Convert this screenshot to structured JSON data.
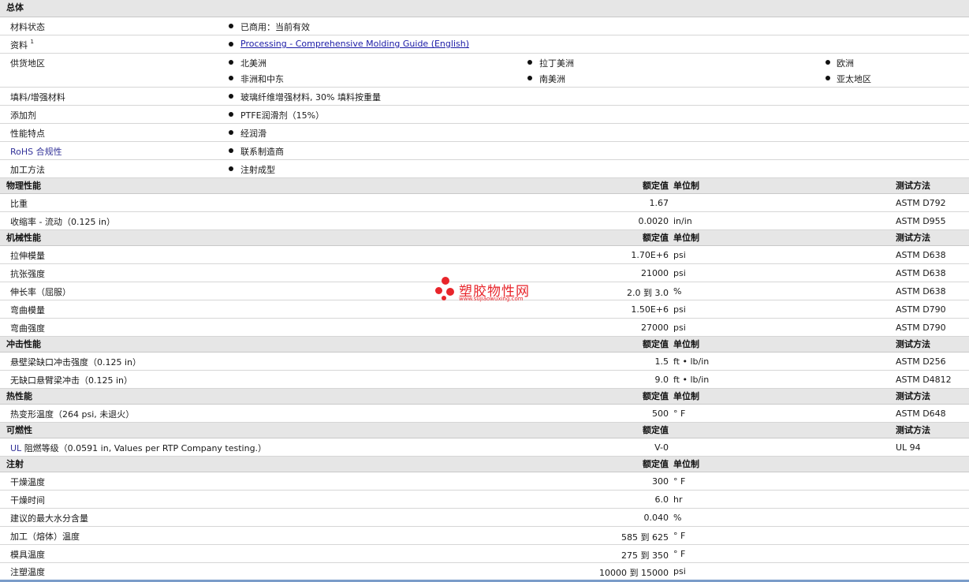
{
  "general": {
    "title": "总体",
    "material_status": {
      "label": "材料状态",
      "value": "已商用：当前有效"
    },
    "documents": {
      "label": "资料",
      "sup": "1",
      "value": "Processing - Comprehensive Molding Guide (English)"
    },
    "regions": {
      "label": "供货地区",
      "items": [
        "北美洲",
        "拉丁美洲",
        "欧洲",
        "非洲和中东",
        "南美洲",
        "亚太地区"
      ]
    },
    "filler": {
      "label": "填料/增强材料",
      "value": "玻璃纤维增强材料, 30% 填料按重量"
    },
    "additive": {
      "label": "添加剂",
      "value": "PTFE润滑剂（15%）"
    },
    "features": {
      "label": "性能特点",
      "value": "经润滑"
    },
    "rohs": {
      "label": "RoHS 合规性",
      "value": "联系制造商"
    },
    "processing": {
      "label": "加工方法",
      "value": "注射成型"
    }
  },
  "col": {
    "nominal": "额定值",
    "unit": "单位制",
    "method": "测试方法"
  },
  "physical": {
    "title": "物理性能",
    "rows": [
      {
        "label": "比重",
        "value": "1.67",
        "unit": "",
        "method": "ASTM D792"
      },
      {
        "label": "收缩率 - 流动（0.125 in）",
        "value": "0.0020",
        "unit": "in/in",
        "method": "ASTM D955"
      }
    ]
  },
  "mechanical": {
    "title": "机械性能",
    "rows": [
      {
        "label": "拉伸模量",
        "value": "1.70E+6",
        "unit": "psi",
        "method": "ASTM D638"
      },
      {
        "label": "抗张强度",
        "value": "21000",
        "unit": "psi",
        "method": "ASTM D638"
      },
      {
        "label": "伸长率（屈服）",
        "value": "2.0 到  3.0",
        "unit": "%",
        "method": "ASTM D638"
      },
      {
        "label": "弯曲模量",
        "value": "1.50E+6",
        "unit": "psi",
        "method": "ASTM D790"
      },
      {
        "label": "弯曲强度",
        "value": "27000",
        "unit": "psi",
        "method": "ASTM D790"
      }
    ]
  },
  "impact": {
    "title": "冲击性能",
    "rows": [
      {
        "label": "悬壁梁缺口冲击强度（0.125 in）",
        "value": "1.5",
        "unit": "ft • lb/in",
        "method": "ASTM D256"
      },
      {
        "label": "无缺口悬臂梁冲击（0.125 in）",
        "value": "9.0",
        "unit": "ft • lb/in",
        "method": "ASTM D4812"
      }
    ]
  },
  "thermal": {
    "title": "热性能",
    "rows": [
      {
        "label": "热变形温度（264 psi, 未退火）",
        "value": "500",
        "unit": "° F",
        "method": "ASTM D648"
      }
    ]
  },
  "flammability": {
    "title": "可燃性",
    "rows": [
      {
        "label": "UL 阻燃等级（0.0591 in, Values per RTP Company testing.）",
        "value": "V-0",
        "unit": "",
        "method": "UL 94"
      }
    ]
  },
  "injection": {
    "title": "注射",
    "rows": [
      {
        "label": "干燥温度",
        "value": "300",
        "unit": "° F"
      },
      {
        "label": "干燥时间",
        "value": "6.0",
        "unit": "hr"
      },
      {
        "label": "建议的最大水分含量",
        "value": "0.040",
        "unit": "%"
      },
      {
        "label": "加工（熔体）温度",
        "value": "585 到  625",
        "unit": "° F"
      },
      {
        "label": "模具温度",
        "value": "275 到  350",
        "unit": "° F"
      },
      {
        "label": "注塑温度",
        "value": "10000 到  15000",
        "unit": "psi"
      }
    ]
  },
  "watermark": {
    "title": "塑胶物性网",
    "url": "www.sujiaowuxing.com"
  },
  "colors": {
    "header_bg": "#e6e6e6",
    "link": "#1a1aa6",
    "watermark": "#e8252b"
  }
}
